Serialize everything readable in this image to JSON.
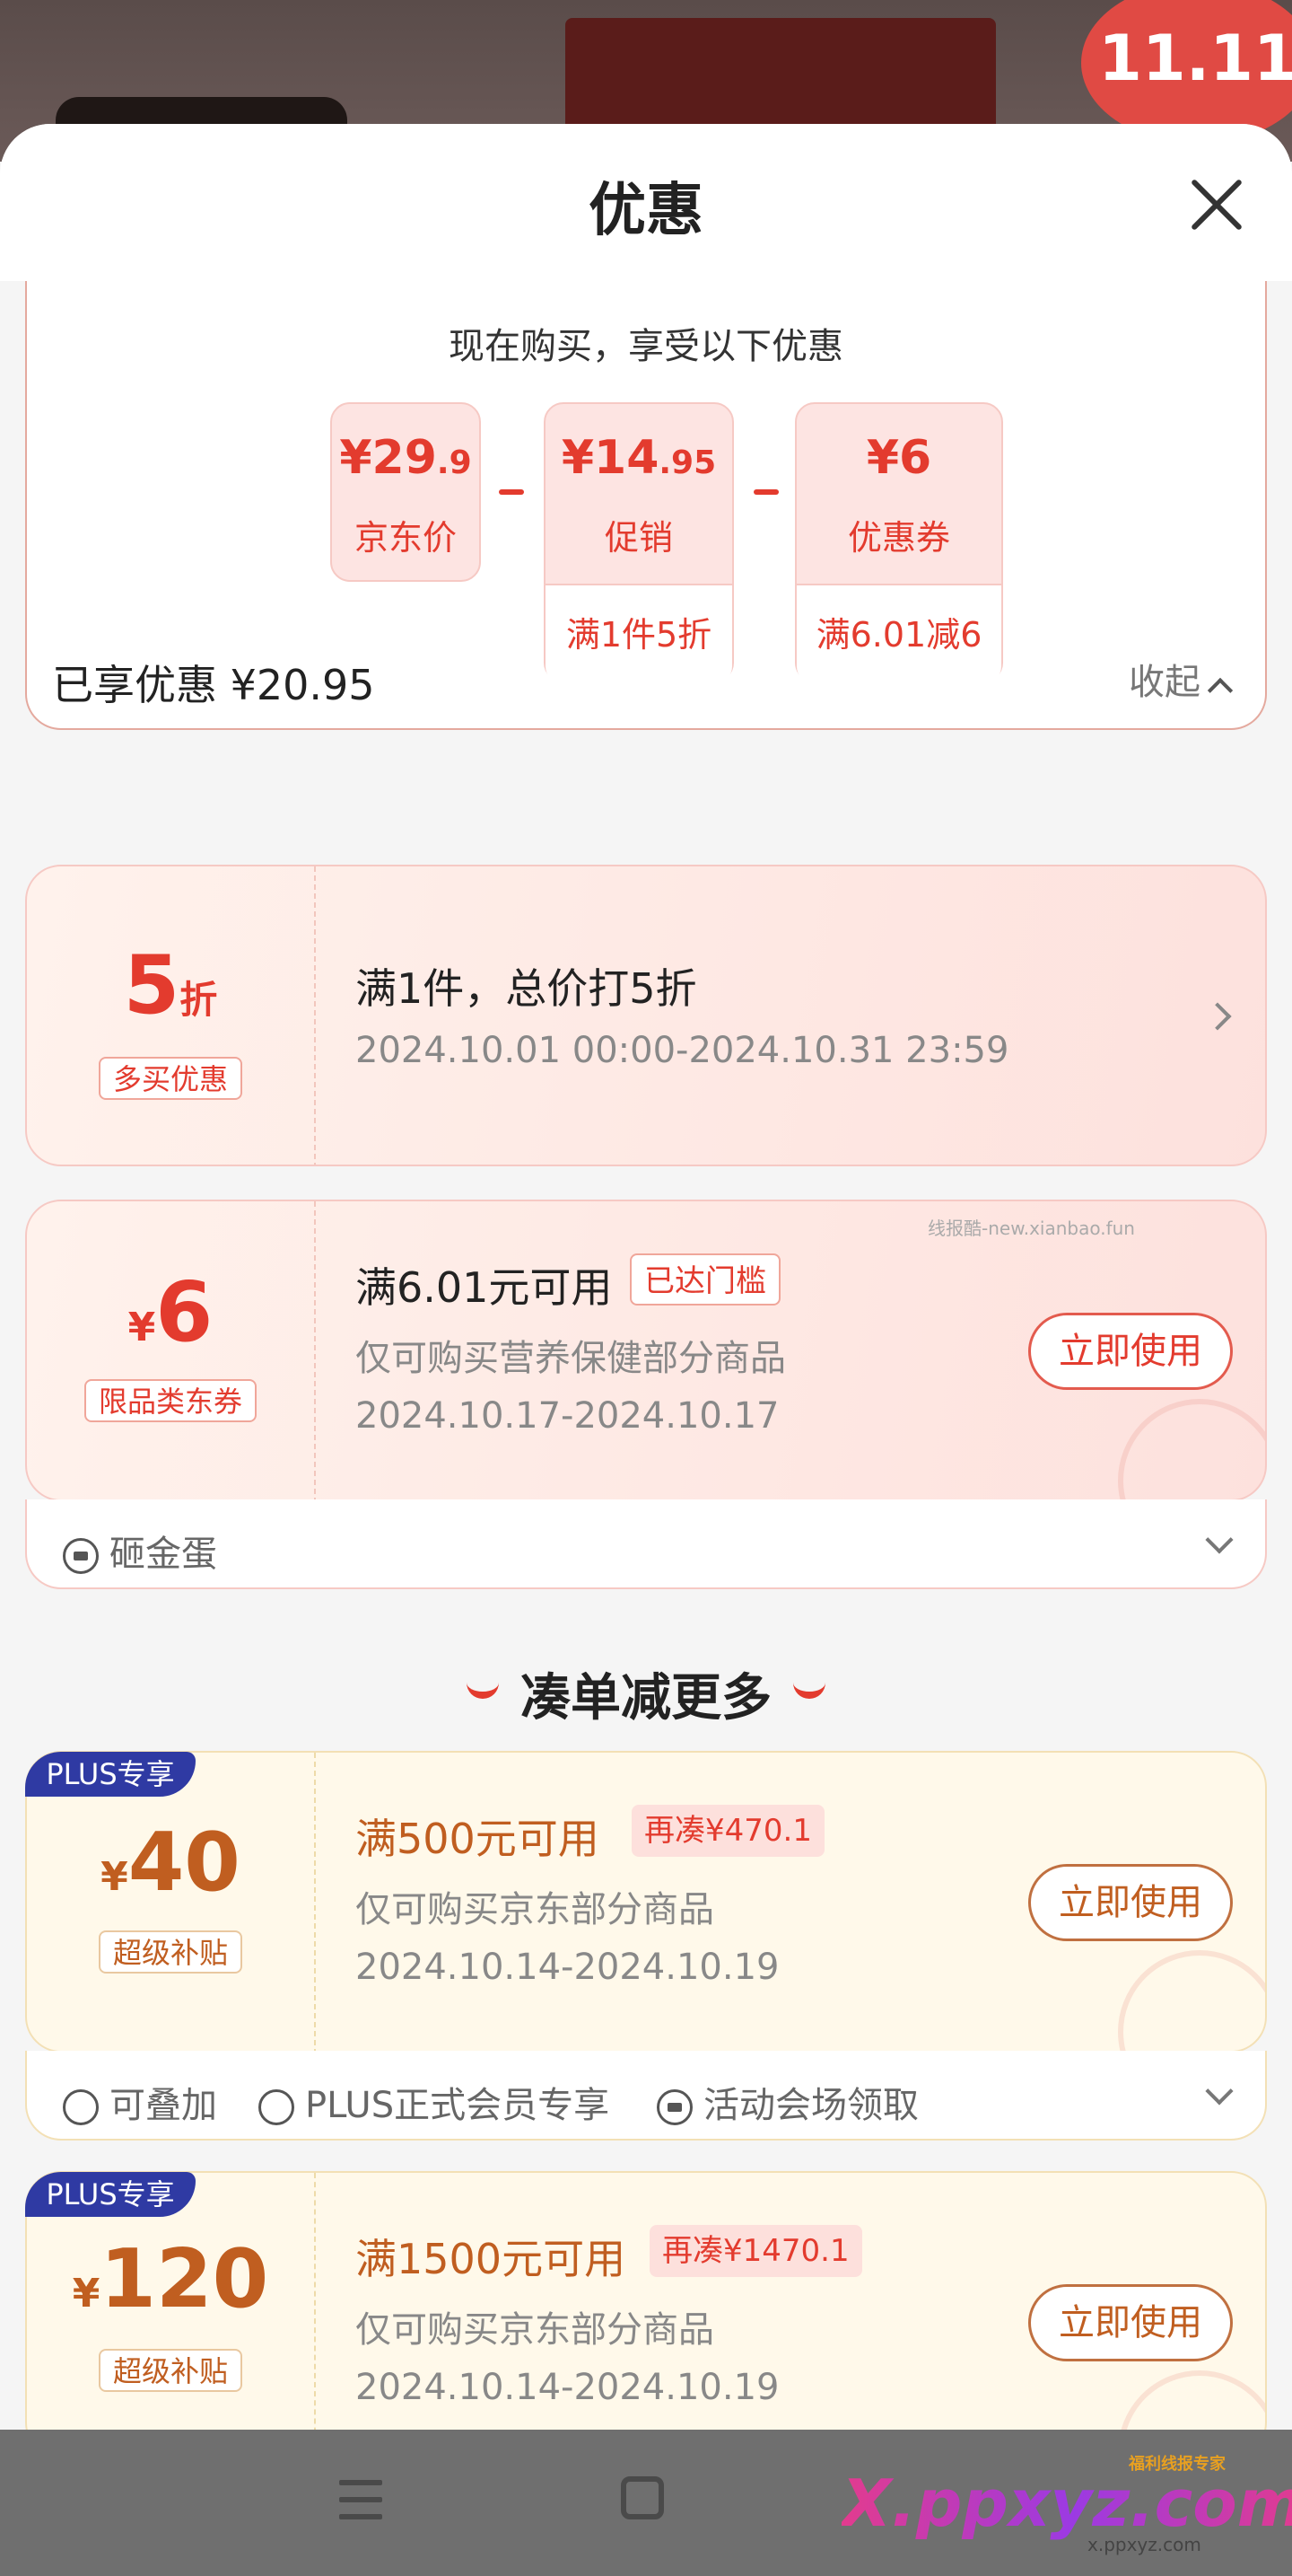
{
  "background": {
    "badge_text": "11.11"
  },
  "sheet": {
    "title": "优惠"
  },
  "summary": {
    "text": "现在购买，享受以下优惠",
    "boxes": [
      {
        "amount_main": "¥29",
        "amount_dec": ".9",
        "label": "京东价",
        "condition": ""
      },
      {
        "amount_main": "¥14",
        "amount_dec": ".95",
        "label": "促销",
        "condition": "满1件5折"
      },
      {
        "amount_main": "¥6",
        "amount_dec": "",
        "label": "优惠券",
        "condition": "满6.01减6"
      }
    ]
  },
  "enjoyed": {
    "label": "已享优惠 ¥20.95",
    "collapse_label": "收起"
  },
  "card_discount": {
    "value": "5",
    "unit": "折",
    "tag": "多买优惠",
    "title": "满1件，总价打5折",
    "time": "2024.10.01 00:00-2024.10.31 23:59"
  },
  "card_coupon": {
    "currency": "¥",
    "value": "6",
    "tag": "限品类东券",
    "title": "满6.01元可用",
    "badge": "已达门槛",
    "scope": "仅可购买营养保健部分商品",
    "time": "2024.10.17-2024.10.17",
    "button": "立即使用",
    "watermark": "线报酷-new.xianbao.fun",
    "footer": "砸金蛋"
  },
  "more_heading": "凑单减更多",
  "plus_cards": [
    {
      "badge": "PLUS专享",
      "currency": "¥",
      "value": "40",
      "tag": "超级补贴",
      "title": "满500元可用",
      "need": "再凑¥470.1",
      "scope": "仅可购买京东部分商品",
      "time": "2024.10.14-2024.10.19",
      "button": "立即使用",
      "footer_items": [
        "可叠加",
        "PLUS正式会员专享",
        "活动会场领取"
      ]
    },
    {
      "badge": "PLUS专享",
      "currency": "¥",
      "value": "120",
      "tag": "超级补贴",
      "title": "满1500元可用",
      "need": "再凑¥1470.1",
      "scope": "仅可购买京东部分商品",
      "time": "2024.10.14-2024.10.19",
      "button": "立即使用"
    }
  ],
  "watermark": {
    "brand": "X.ppxyz.com",
    "sub": "福利线报专家",
    "url": "x.ppxyz.com"
  },
  "colors": {
    "accent": "#e33b2e",
    "plus": "#2f3aa3",
    "gold": "#c05e20"
  }
}
